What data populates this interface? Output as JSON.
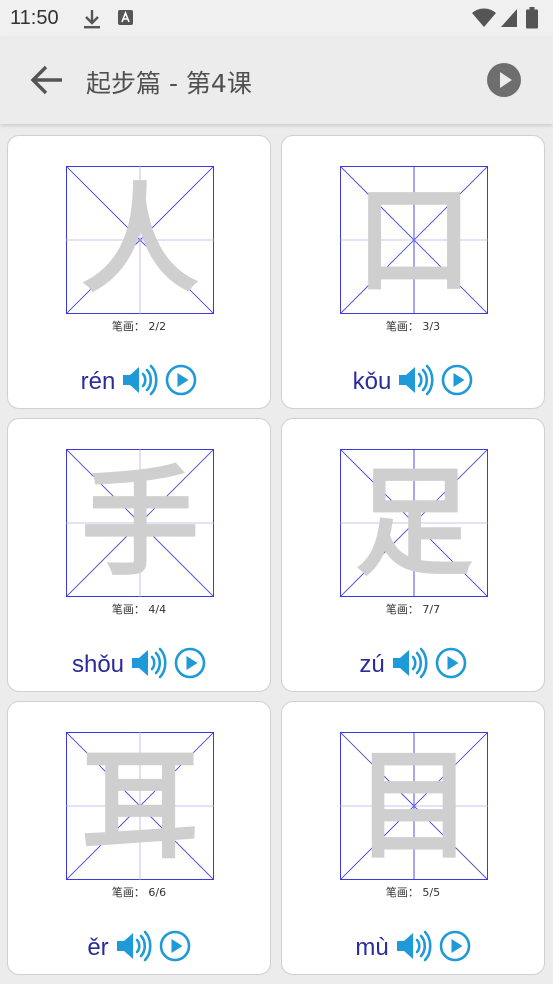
{
  "status": {
    "time": "11:50"
  },
  "toolbar": {
    "title": "起步篇 - 第4课"
  },
  "colors": {
    "accent": "#1e9ad8",
    "pinyin": "#2b2b99",
    "grid": "#3a3ae0"
  },
  "cards": [
    {
      "character": "人",
      "stroke_label": "笔画：",
      "stroke_count": "2/2",
      "pinyin": "rén"
    },
    {
      "character": "口",
      "stroke_label": "笔画：",
      "stroke_count": "3/3",
      "pinyin": "kǒu"
    },
    {
      "character": "手",
      "stroke_label": "笔画：",
      "stroke_count": "4/4",
      "pinyin": "shǒu"
    },
    {
      "character": "足",
      "stroke_label": "笔画：",
      "stroke_count": "7/7",
      "pinyin": "zú"
    },
    {
      "character": "耳",
      "stroke_label": "笔画：",
      "stroke_count": "6/6",
      "pinyin": "ěr"
    },
    {
      "character": "目",
      "stroke_label": "笔画：",
      "stroke_count": "5/5",
      "pinyin": "mù"
    }
  ]
}
